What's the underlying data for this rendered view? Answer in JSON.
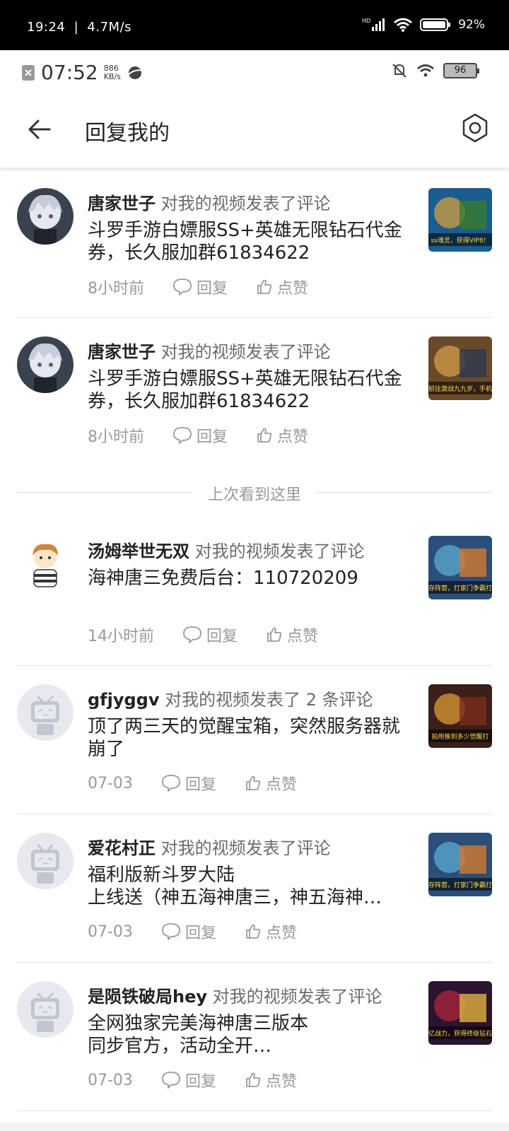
{
  "system_bar": {
    "time": "19:24",
    "speed": "4.7M/s",
    "battery": "92%"
  },
  "status_bar2": {
    "time": "07:52",
    "speed_value": "886",
    "speed_unit": "KB/s",
    "battery": "96"
  },
  "header": {
    "title": "回复我的"
  },
  "comments": [
    {
      "user": "唐家世子",
      "action": "对我的视频发表了评论",
      "content": "斗罗手游白嫖服SS+英雄无限钻石代金券，长久服加群61834622",
      "time": "8小时前",
      "reply_label": "回复",
      "like_label": "点赞",
      "avatar": "anime-boy"
    },
    {
      "user": "唐家世子",
      "action": "对我的视频发表了评论",
      "content": "斗罗手游白嫖服SS+英雄无限钻石代金券，长久服加群61834622",
      "time": "8小时前",
      "reply_label": "回复",
      "like_label": "点赞",
      "avatar": "anime-boy"
    },
    {
      "user": "汤姆举世无双",
      "action": "对我的视频发表了评论",
      "content": "海神唐三免费后台：110720209",
      "time": "14小时前",
      "reply_label": "回复",
      "like_label": "点赞",
      "avatar": "cartoon-boy"
    },
    {
      "user": "gfjyggv",
      "action": "对我的视频发表了 2 条评论",
      "content": "顶了两三天的觉醒宝箱，突然服务器就崩了",
      "time": "07-03",
      "reply_label": "回复",
      "like_label": "点赞",
      "avatar": "default-tv"
    },
    {
      "user": "爱花村正",
      "action": "对我的视频发表了评论",
      "content": "福利版新斗罗大陆\n上线送（神五海神唐三，神五海神…",
      "time": "07-03",
      "reply_label": "回复",
      "like_label": "点赞",
      "avatar": "default-tv"
    },
    {
      "user": "是陨铁破局hey",
      "action": "对我的视频发表了评论",
      "content": "全网独家完美海神唐三版本\n同步官方，活动全开…",
      "time": "07-03",
      "reply_label": "回复",
      "like_label": "点赞",
      "avatar": "default-tv"
    }
  ],
  "last_seen_label": "上次看到这里",
  "thumb_texts": [
    "ss魂灵，获得VIP8！",
    "前往激战九九岁，手机",
    "存阵营，打家门争霸打",
    "拍用推到多少觉醒打",
    "存阵营，打家门争霸打",
    "亿战力，获得终级钻石"
  ],
  "colors": {
    "accent": "#fb7299",
    "text": "#222222",
    "muted": "#999999"
  }
}
